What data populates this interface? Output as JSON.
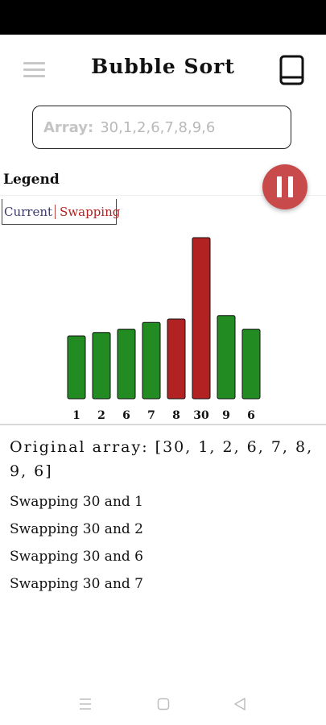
{
  "app": {
    "title": "Bubble Sort",
    "icons": {
      "menu": "hamburger-menu-icon",
      "book": "book-icon",
      "pause": "pause-icon"
    }
  },
  "input": {
    "label": "Array:",
    "value": "30,1,2,6,7,8,9,6"
  },
  "legend": {
    "title": "Legend",
    "current": "Current",
    "swapping": "Swapping"
  },
  "colors": {
    "normal": "#228b22",
    "swapping": "#b22222",
    "fab": "#c94a4a",
    "current_text": "#3d3a6c"
  },
  "chart_data": {
    "type": "bar",
    "categories": [
      "1",
      "2",
      "6",
      "7",
      "8",
      "30",
      "9",
      "6"
    ],
    "values": [
      1,
      2,
      6,
      7,
      8,
      30,
      9,
      6
    ],
    "states": [
      "normal",
      "normal",
      "normal",
      "normal",
      "swapping",
      "swapping",
      "normal",
      "normal"
    ],
    "title": "",
    "xlabel": "",
    "ylabel": ""
  },
  "log": {
    "original": "Original array: [30, 1, 2, 6, 7, 8, 9, 6]",
    "lines": [
      "Swapping 30 and 1",
      "Swapping 30 and 2",
      "Swapping 30 and 6",
      "Swapping 30 and 7"
    ]
  },
  "nav": {
    "icons": [
      "recents-icon",
      "home-icon",
      "back-icon"
    ]
  }
}
